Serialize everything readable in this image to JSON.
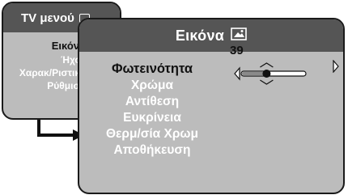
{
  "tv_menu": {
    "title": "TV μενού",
    "icon": "tv-icon",
    "items": [
      {
        "label": "Εικόνα",
        "selected": true
      },
      {
        "label": "Ήχος",
        "selected": false
      },
      {
        "label": "Χαρακ/Ριστικά",
        "selected": false
      },
      {
        "label": "Ρύθμιση",
        "selected": false
      }
    ]
  },
  "picture_menu": {
    "title": "Εικόνα",
    "icon": "picture-icon",
    "items": [
      {
        "label": "Φωτεινότητα",
        "selected": true
      },
      {
        "label": "Χρώμα",
        "selected": false
      },
      {
        "label": "Αντίθεση",
        "selected": false
      },
      {
        "label": "Ευκρίνεια",
        "selected": false
      },
      {
        "label": "Θερμ/σία Χρωμ",
        "selected": false
      },
      {
        "label": "Αποθήκευση",
        "selected": false
      }
    ]
  },
  "slider": {
    "label": "Φωτεινότητα",
    "value": "39",
    "level": 0.39
  },
  "colors": {
    "panel_bg": "#bcbcbc",
    "title_bg": "#555555",
    "text_normal": "#ffffff",
    "text_selected": "#111111"
  }
}
